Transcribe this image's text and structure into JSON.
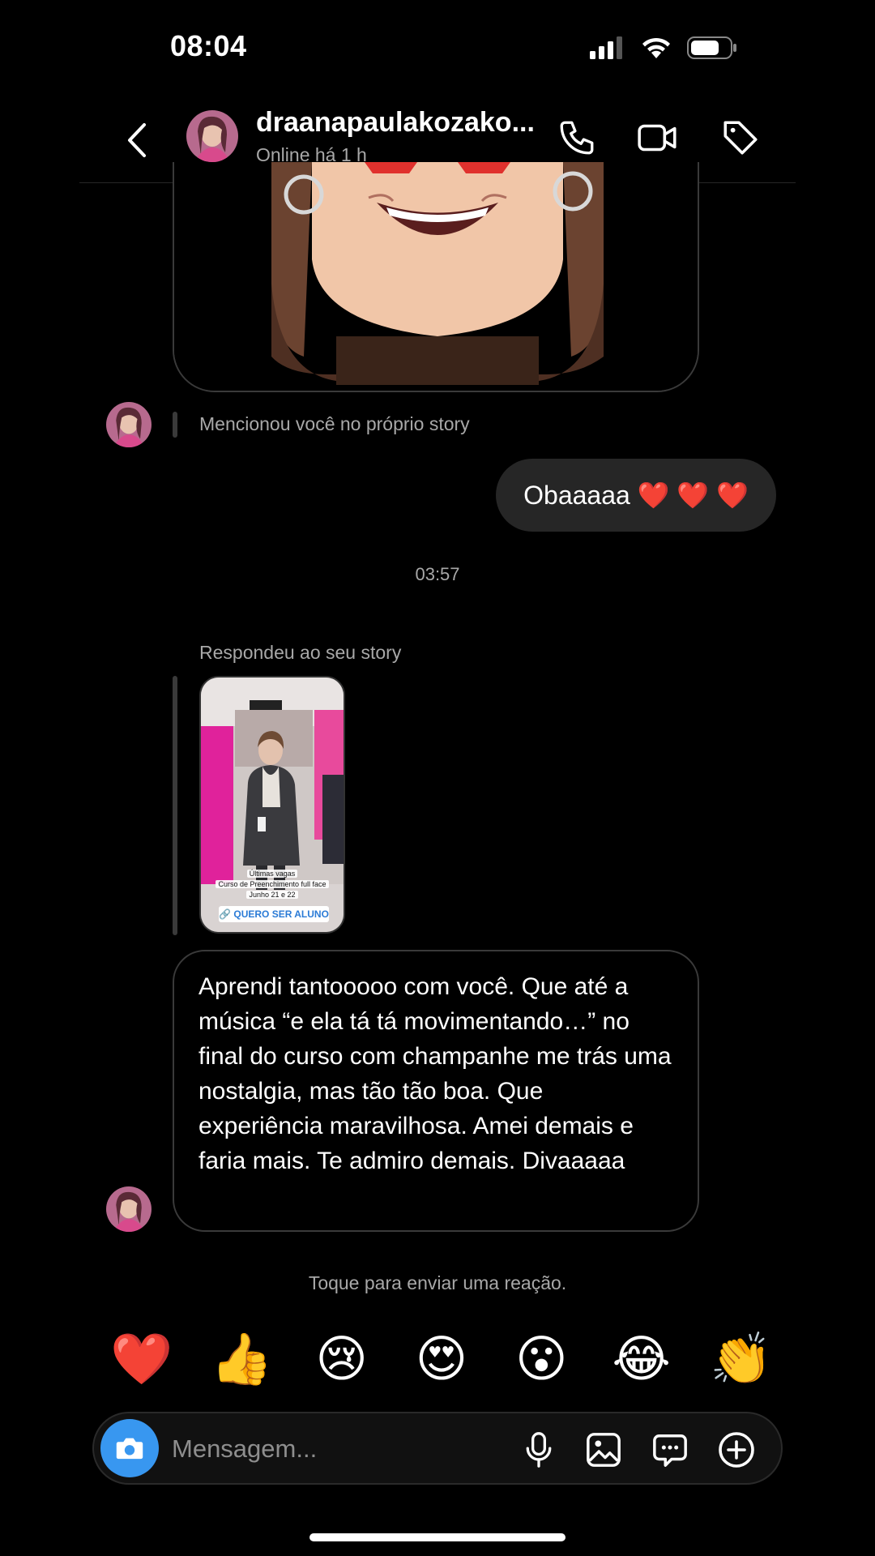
{
  "status_bar": {
    "time": "08:04"
  },
  "header": {
    "contact_name": "draanapaulakozako...",
    "contact_status": "Online há 1 h"
  },
  "thread": {
    "story_mention_note": "Mencionou você no próprio story",
    "sent_message": "Obaaaaa ❤️ ❤️ ❤️",
    "timestamp": "03:57",
    "story_reply_note": "Respondeu ao seu story",
    "story": {
      "caption_line1": "Últimas vagas",
      "caption_line2": "Curso de Preenchimento full face",
      "caption_line3": "Junho 21 e 22",
      "cta": "🔗 QUERO SER ALUNO"
    },
    "received_message": "Aprendi tantooooo com você. Que até a música “e ela tá tá movimentando…” no final do curso com champanhe me trás uma nostalgia, mas tão tão boa. Que experiência maravilhosa. Amei demais e faria mais. Te admiro demais. Divaaaaa"
  },
  "reaction_hint": "Toque para enviar uma reação.",
  "reactions": [
    "❤️",
    "👍",
    "😢",
    "😍",
    "😮",
    "😂",
    "👏"
  ],
  "composer": {
    "placeholder": "Mensagem..."
  },
  "icons": {
    "back": "chevron-left-icon",
    "call": "phone-icon",
    "video": "video-camera-icon",
    "tag": "tag-icon",
    "camera": "camera-icon",
    "mic": "microphone-icon",
    "gallery": "image-icon",
    "sticker": "chat-bubble-icon",
    "add": "plus-circle-icon"
  },
  "colors": {
    "background": "#000000",
    "sent_bubble": "#262626",
    "camera_button": "#3897f0",
    "muted_text": "#a8a8a8"
  }
}
